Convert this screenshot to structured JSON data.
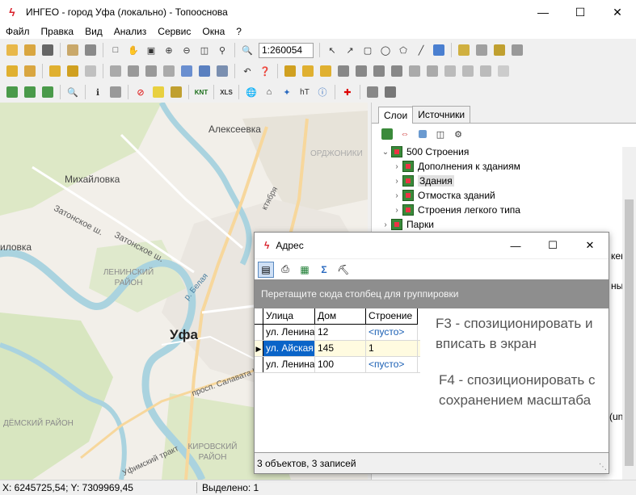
{
  "window": {
    "title": "ИНГЕО - город Уфа (локально) - Топооснова"
  },
  "menu": [
    "Файл",
    "Правка",
    "Вид",
    "Анализ",
    "Сервис",
    "Окна",
    "?"
  ],
  "toolbar": {
    "scale": "1:260054",
    "xls_label": "XLS",
    "knt_label": "KNT"
  },
  "map": {
    "labels": [
      "Алексеевка",
      "Михайловка",
      "Затонское ш.",
      "Затонское ш.",
      "иловка",
      "ЛЕНИНСКИЙ РАЙОН",
      "Уфа",
      "просп. Салавата Юлаева",
      "ДЁМСКИЙ РАЙОН",
      "КИРОВСКИЙ РАЙОН",
      "ОРДЖОНИКИ",
      "ктября",
      "Уфимский тракт",
      "р. Белая"
    ]
  },
  "layers_panel": {
    "tabs": [
      "Слои",
      "Источники"
    ],
    "items": [
      {
        "label": "500 Строения",
        "level": 0,
        "expanded": true
      },
      {
        "label": "Дополнения к зданиям",
        "level": 1
      },
      {
        "label": "Здания",
        "level": 1,
        "selected": true
      },
      {
        "label": "Отмостка зданий",
        "level": 1
      },
      {
        "label": "Строения легкого типа",
        "level": 1
      },
      {
        "label": "Парки",
        "level": 0
      }
    ],
    "clipped_fragments": [
      "кен",
      "ные",
      "(un"
    ]
  },
  "dialog": {
    "title": "Адрес",
    "group_prompt": "Перетащите сюда столбец для группировки",
    "columns": [
      "Улица",
      "Дом",
      "Строение"
    ],
    "rows": [
      [
        "ул. Ленина",
        "12",
        "<пусто>"
      ],
      [
        "ул. Айская",
        "145",
        "1"
      ],
      [
        "ул. Ленина",
        "100",
        "<пусто>"
      ]
    ],
    "hint_f3": "F3 - спозиционировать и вписать в экран",
    "hint_f4": "F4 - спозиционировать с сохранением масштаба",
    "status": "3 объектов, 3 записей"
  },
  "statusbar": {
    "coords": "X: 6245725,54; Y: 7309969,45",
    "selected": "Выделено: 1"
  }
}
